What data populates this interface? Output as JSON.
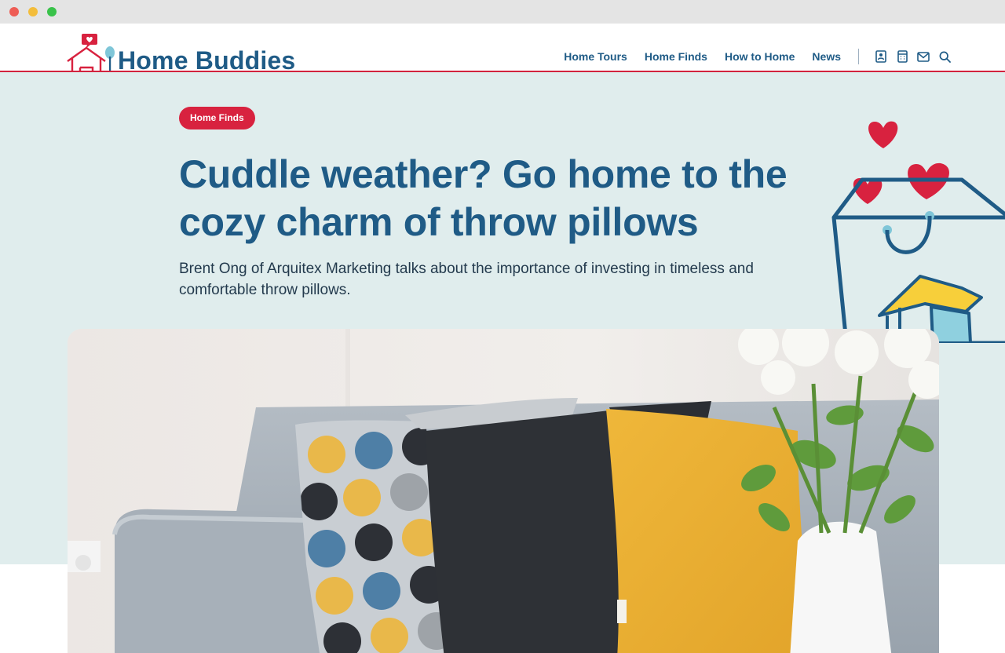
{
  "site": {
    "name": "Home Buddies",
    "brand_colors": {
      "primary": "#1f5b86",
      "accent": "#d8223f",
      "hero_bg": "#e0eded"
    }
  },
  "nav": {
    "links": [
      {
        "label": "Home Tours"
      },
      {
        "label": "Home Finds"
      },
      {
        "label": "How to Home"
      },
      {
        "label": "News"
      }
    ],
    "icons": [
      "contact-card-icon",
      "calendar-icon",
      "mail-icon",
      "search-icon"
    ]
  },
  "article": {
    "category": "Home Finds",
    "title": "Cuddle weather? Go home to the cozy charm of throw pillows",
    "summary": "Brent Ong of Arquitex Marketing talks about the importance of investing in timeless and comfortable throw pillows."
  },
  "hero_image": {
    "subject": "sofa-with-throw-pillows-photo"
  }
}
